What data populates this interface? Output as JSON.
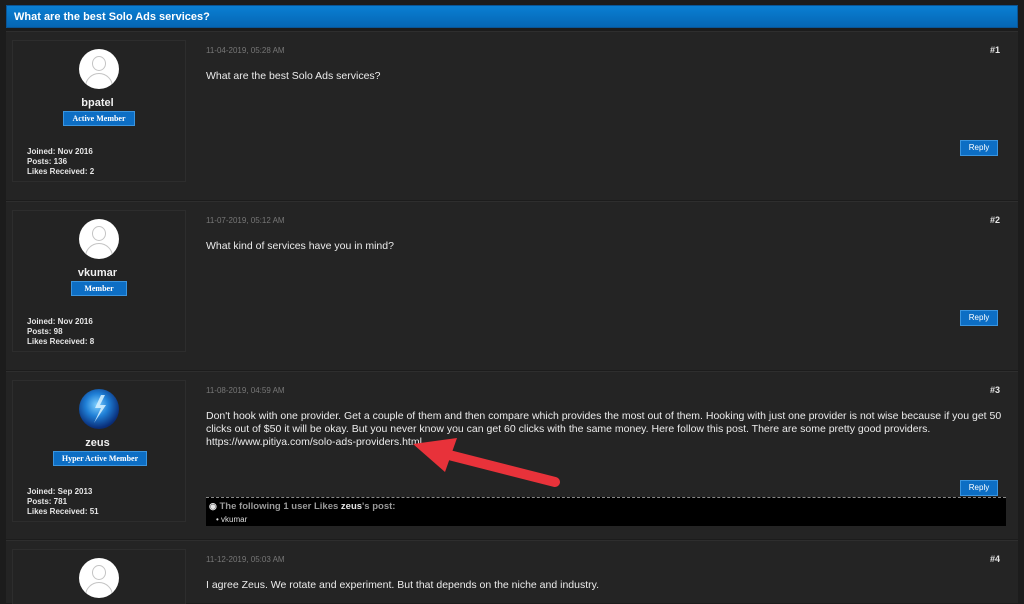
{
  "thread": {
    "title": "What are the best Solo Ads services?"
  },
  "posts": [
    {
      "date": "11-04-2019, 05:28 AM",
      "number": "#1",
      "author": {
        "name": "bpatel",
        "online_icon": "",
        "rank": "Active Member",
        "rank_icon": "",
        "stars": "",
        "joined": "Joined: Nov 2016",
        "posts": "Posts: 136",
        "likes": "Likes Received: 2"
      },
      "body": "What are the best Solo Ads services?",
      "reply_label": " Reply"
    },
    {
      "date": "11-07-2019, 05:12 AM",
      "number": "#2",
      "author": {
        "name": "vkumar",
        "online_icon": "",
        "rank": "Member",
        "rank_icon": "",
        "stars": "",
        "joined": "Joined: Nov 2016",
        "posts": "Posts: 98",
        "likes": "Likes Received: 8"
      },
      "body": "What kind of services have you in mind?",
      "reply_label": " Reply"
    },
    {
      "date": "11-08-2019, 04:59 AM",
      "number": "#3",
      "author": {
        "name": "zeus",
        "online_icon": "",
        "rank": "Hyper Active Member",
        "rank_icon": "",
        "stars": "",
        "joined": "Joined: Sep 2013",
        "posts": "Posts: 781",
        "likes": "Likes Received: 51"
      },
      "body": "Don't hook with one provider. Get a couple of them and then compare which provides the most out of them. Hooking with just one provider is not wise because if you get 50 clicks out of $50 it will be okay. But you never know you can get 60 clicks with the same money. Here follow this post. There are some pretty good providers.",
      "link": "https://www.pitiya.com/solo-ads-providers.html",
      "reply_label": " Reply",
      "likes": {
        "prefix": "The following 1 user Likes ",
        "user": "zeus",
        "suffix": "'s post:",
        "likers": "• vkumar"
      }
    },
    {
      "date": "11-12-2019, 05:03 AM",
      "number": "#4",
      "body": "I agree Zeus. We rotate and experiment. But that depends on the niche and industry."
    }
  ],
  "colors": {
    "header": "#0a7fd3",
    "button": "#0d6ec4",
    "arrow": "#e8323a",
    "stars": "#c8a81e"
  }
}
